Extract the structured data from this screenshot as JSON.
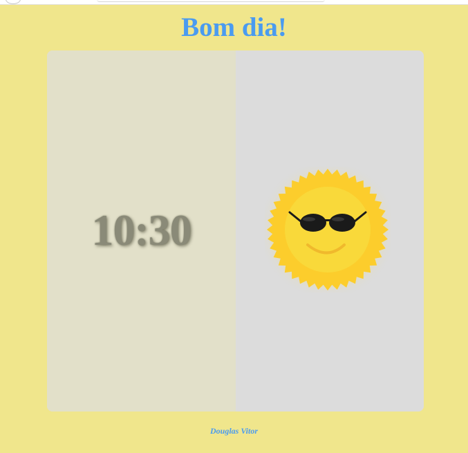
{
  "greeting": "Bom dia!",
  "clock": {
    "time": "10:30"
  },
  "sun_icon": "smiling-sun-with-sunglasses-icon",
  "footer": {
    "author": "Douglas Vitor"
  },
  "colors": {
    "background": "#f0e68c",
    "title": "#4a9bf0",
    "left_panel": "#e2e0c9",
    "right_panel": "#dcdcdc",
    "clock_text": "#8a8a78",
    "sun_outer": "#fccd2c",
    "sun_inner": "#f9d93a",
    "sunglasses": "#111111"
  }
}
